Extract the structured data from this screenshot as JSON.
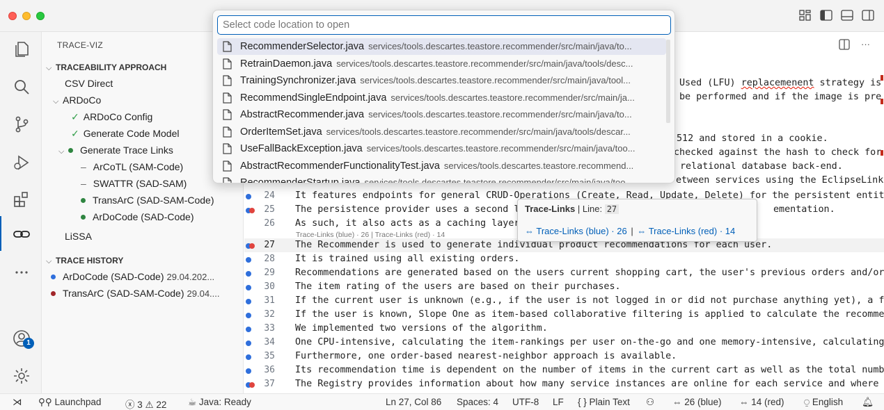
{
  "sidebar": {
    "title": "TRACE-VIZ",
    "section_approach": "TRACEABILITY APPROACH",
    "approach_items": [
      {
        "label": "CSV Direct"
      },
      {
        "label": "ARDoCo"
      },
      {
        "label": "ARDoCo Config"
      },
      {
        "label": "Generate Code Model"
      },
      {
        "label": "Generate Trace Links"
      },
      {
        "label": "ArCoTL (SAM-Code)"
      },
      {
        "label": "SWATTR (SAD-SAM)"
      },
      {
        "label": "TransArC (SAD-SAM-Code)"
      },
      {
        "label": "ArDoCode (SAD-Code)"
      },
      {
        "label": "LiSSA"
      }
    ],
    "section_history": "TRACE HISTORY",
    "history_items": [
      {
        "label": "ArDoCode (SAD-Code)",
        "date": "29.04.202...",
        "color": "#2f6fdc"
      },
      {
        "label": "TransArC (SAD-SAM-Code)",
        "date": "29.04....",
        "color": "#a1262a"
      }
    ]
  },
  "activity": {
    "account_badge": "1"
  },
  "quick_pick": {
    "placeholder": "Select code location to open",
    "items": [
      {
        "name": "RecommenderSelector.java",
        "path": "services/tools.descartes.teastore.recommender/src/main/java/to..."
      },
      {
        "name": "RetrainDaemon.java",
        "path": "services/tools.descartes.teastore.recommender/src/main/java/tools/desc..."
      },
      {
        "name": "TrainingSynchronizer.java",
        "path": "services/tools.descartes.teastore.recommender/src/main/java/tool..."
      },
      {
        "name": "RecommendSingleEndpoint.java",
        "path": "services/tools.descartes.teastore.recommender/src/main/ja..."
      },
      {
        "name": "AbstractRecommender.java",
        "path": "services/tools.descartes.teastore.recommender/src/main/java/to..."
      },
      {
        "name": "OrderItemSet.java",
        "path": "services/tools.descartes.teastore.recommender/src/main/java/tools/descar..."
      },
      {
        "name": "UseFallBackException.java",
        "path": "services/tools.descartes.teastore.recommender/src/main/java/too..."
      },
      {
        "name": "AbstractRecommenderFunctionalityTest.java",
        "path": "services/tools.descartes.teastore.recommend..."
      },
      {
        "name": "RecommenderStartup.java",
        "path": "services/tools.descartes.teastore.recommender/src/main/java/too..."
      }
    ]
  },
  "editor": {
    "partial_lines": [
      {
        "pre": "Used (LFU) ",
        "squiggle": "replacemenent",
        "post": " strategy is"
      },
      {
        "pre": "be performed and if the image is pre",
        "squiggle": "",
        "post": ""
      },
      {
        "pre": "512 and stored in a cookie.",
        "squiggle": "",
        "post": ""
      },
      {
        "pre": "checked against the hash to check for",
        "squiggle": "",
        "post": ""
      },
      {
        "pre": "relational database back-end.",
        "squiggle": "",
        "post": ""
      },
      {
        "pre": "etween services using the EclipseLink",
        "squiggle": "",
        "post": ""
      }
    ],
    "lines": [
      {
        "num": "24",
        "text": "It features endpoints for general CRUD-Operations (Create, Read, Update, Delete) for the persistent entit",
        "dots": [
          "blue"
        ]
      },
      {
        "num": "25",
        "text": "The persistence provider uses a second l",
        "dots": [
          "blue",
          "red"
        ],
        "tail": "ementation."
      },
      {
        "num": "26",
        "text": "As such, it also acts as a caching layer",
        "dots": []
      },
      {
        "num": "27",
        "text": "The Recommender is used to generate individual product recommendations for each user.",
        "dots": [
          "blue",
          "red"
        ],
        "highlight": true
      },
      {
        "num": "28",
        "text": "It is trained using all existing orders.",
        "dots": [
          "blue"
        ]
      },
      {
        "num": "29",
        "text": "Recommendations are generated based on the users current shopping cart, the user's previous orders and/or",
        "dots": [
          "blue"
        ]
      },
      {
        "num": "30",
        "text": "The item rating of the users are based on their purchases.",
        "dots": [
          "blue"
        ]
      },
      {
        "num": "31",
        "text": "If the current user is unknown (e.g., if the user is not logged in or did not purchase anything yet), a f",
        "dots": [
          "blue"
        ]
      },
      {
        "num": "32",
        "text": "If the user is known, Slope One as item-based collaborative filtering is applied to calculate the recomme",
        "dots": [
          "blue"
        ]
      },
      {
        "num": "33",
        "text": "We implemented two versions of the algorithm.",
        "dots": [
          "blue"
        ]
      },
      {
        "num": "34",
        "text": "One CPU-intensive, calculating the item-rankings per user on-the-go and one memory-intensive, calculating",
        "dots": [
          "blue"
        ]
      },
      {
        "num": "35",
        "text": "Furthermore, one order-based nearest-neighbor approach is available.",
        "dots": [
          "blue"
        ]
      },
      {
        "num": "36",
        "text": "Its recommendation time is dependent on the number of items in the current cart as well as the total numb",
        "dots": [
          "blue"
        ]
      },
      {
        "num": "37",
        "text": "The Registry provides information about how many service instances are online for each service and where",
        "dots": [
          "blue",
          "red"
        ]
      }
    ],
    "codelens": "Trace-Links (blue) · 26 | Trace-Links (red) · 14",
    "hover": {
      "title": "Trace-Links",
      "line_label": "| Line:",
      "line_value": "27",
      "link_blue": "Trace-Links (blue) · 26",
      "separator": "|",
      "link_red": "Trace-Links (red) · 14"
    }
  },
  "status": {
    "launchpad": "Launchpad",
    "errors": "3",
    "warnings": "22",
    "java": "Java: Ready",
    "position": "Ln 27, Col 86",
    "spaces": "Spaces: 4",
    "encoding": "UTF-8",
    "eol": "LF",
    "language": "Plain Text",
    "blue_links": "26 (blue)",
    "red_links": "14 (red)",
    "spell": "English"
  },
  "colors": {
    "accent": "#005fb8",
    "blue_dot": "#2f6fdc",
    "red_dot": "#e0443e"
  }
}
